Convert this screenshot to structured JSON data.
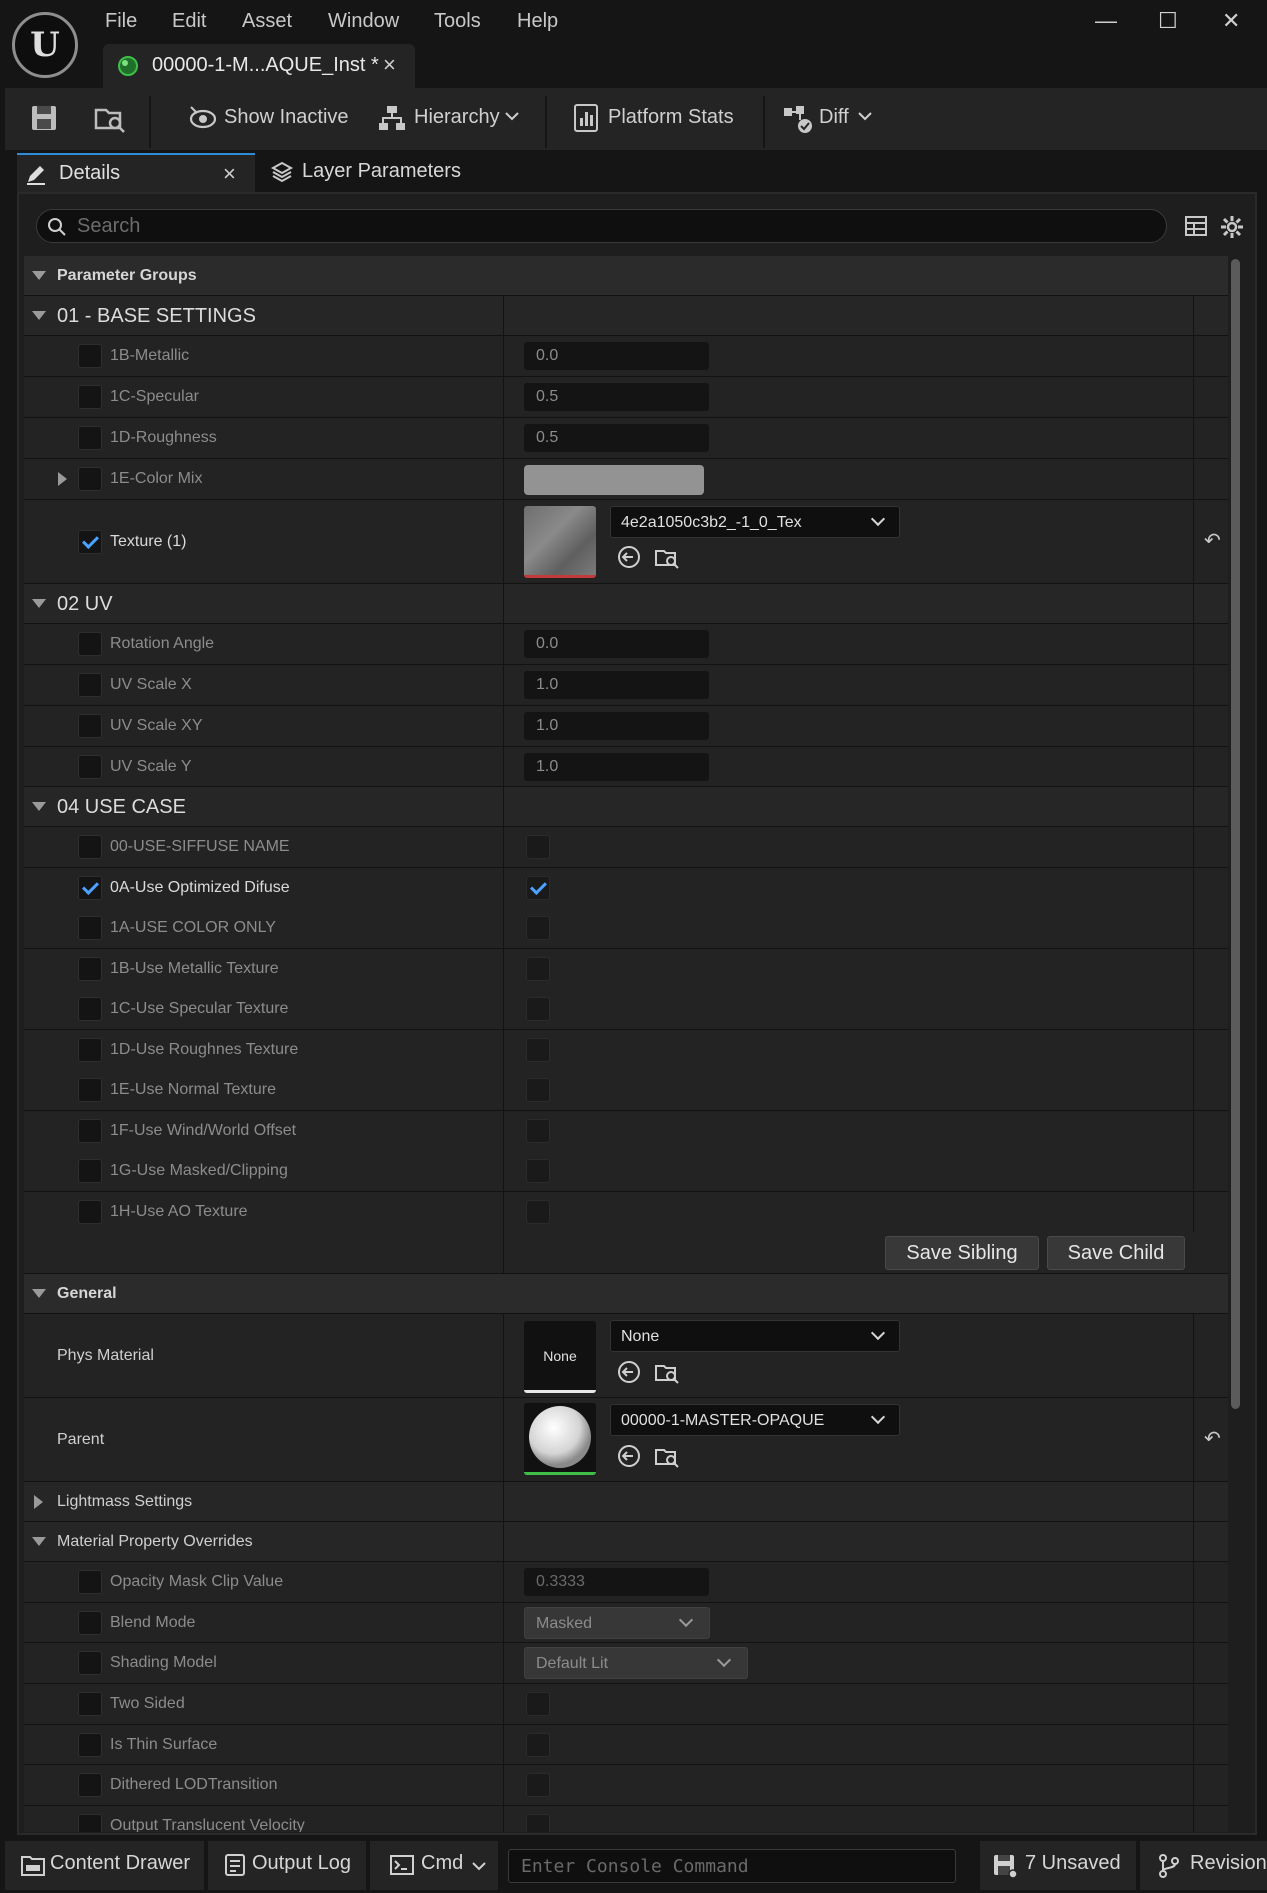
{
  "app": {
    "menu": [
      "File",
      "Edit",
      "Asset",
      "Window",
      "Tools",
      "Help"
    ],
    "tab_title": "00000-1-M...AQUE_Inst",
    "tab_dirty": "*",
    "close_glyph": "×",
    "window_buttons": {
      "minimize": "—",
      "maximize": "☐",
      "close": "✕"
    }
  },
  "toolbar": {
    "show_inactive": "Show Inactive",
    "hierarchy": "Hierarchy",
    "platform_stats": "Platform Stats",
    "diff": "Diff"
  },
  "tabs": {
    "details": "Details",
    "layer_parameters": "Layer Parameters"
  },
  "search": {
    "placeholder": "Search"
  },
  "parameter_groups": {
    "header": "Parameter Groups",
    "base_settings": {
      "title": "01 - BASE SETTINGS",
      "metallic": {
        "label": "1B-Metallic",
        "value": "0.0"
      },
      "specular": {
        "label": "1C-Specular",
        "value": "0.5"
      },
      "roughness": {
        "label": "1D-Roughness",
        "value": "0.5"
      },
      "color_mix": {
        "label": "1E-Color Mix",
        "color": "#939393"
      },
      "texture": {
        "label": "Texture (1)",
        "asset": "4e2a1050c3b2_-1_0_Tex"
      }
    },
    "uv": {
      "title": "02 UV",
      "rotation": {
        "label": "Rotation Angle",
        "value": "0.0"
      },
      "scale_x": {
        "label": "UV Scale X",
        "value": "1.0"
      },
      "scale_xy": {
        "label": "UV Scale XY",
        "value": "1.0"
      },
      "scale_y": {
        "label": "UV Scale Y",
        "value": "1.0"
      }
    },
    "use_case": {
      "title": "04 USE CASE",
      "items": [
        {
          "label": "00-USE-SIFFUSE NAME",
          "override": false,
          "value": false
        },
        {
          "label": "0A-Use Optimized Difuse",
          "override": true,
          "value": true
        },
        {
          "label": "1A-USE COLOR ONLY",
          "override": false,
          "value": false
        },
        {
          "label": "1B-Use Metallic Texture",
          "override": false,
          "value": false
        },
        {
          "label": "1C-Use Specular Texture",
          "override": false,
          "value": false
        },
        {
          "label": "1D-Use Roughnes Texture",
          "override": false,
          "value": false
        },
        {
          "label": "1E-Use Normal Texture",
          "override": false,
          "value": false
        },
        {
          "label": "1F-Use Wind/World Offset",
          "override": false,
          "value": false
        },
        {
          "label": "1G-Use Masked/Clipping",
          "override": false,
          "value": false
        },
        {
          "label": "1H-Use AO Texture",
          "override": false,
          "value": false
        }
      ]
    },
    "save_sibling": "Save Sibling",
    "save_child": "Save Child"
  },
  "general": {
    "header": "General",
    "phys_material": {
      "label": "Phys Material",
      "thumb_text": "None",
      "asset": "None"
    },
    "parent": {
      "label": "Parent",
      "asset": "00000-1-MASTER-OPAQUE"
    }
  },
  "lightmass": {
    "header": "Lightmass Settings"
  },
  "overrides": {
    "header": "Material Property Overrides",
    "opacity_mask": {
      "label": "Opacity Mask Clip Value",
      "value": "0.3333"
    },
    "blend_mode": {
      "label": "Blend Mode",
      "value": "Masked"
    },
    "shading_model": {
      "label": "Shading Model",
      "value": "Default Lit"
    },
    "two_sided": {
      "label": "Two Sided"
    },
    "thin_surface": {
      "label": "Is Thin Surface"
    },
    "dithered": {
      "label": "Dithered LODTransition"
    },
    "output_velocity": {
      "label": "Output Translucent Velocity"
    }
  },
  "statusbar": {
    "content_drawer": "Content Drawer",
    "output_log": "Output Log",
    "cmd": "Cmd",
    "console_placeholder": "Enter Console Command",
    "unsaved": "7 Unsaved",
    "revision": "Revision"
  },
  "colors": {
    "accent": "#2f8cd8",
    "check": "#4aa3ff",
    "panel": "#1e1e1e"
  }
}
